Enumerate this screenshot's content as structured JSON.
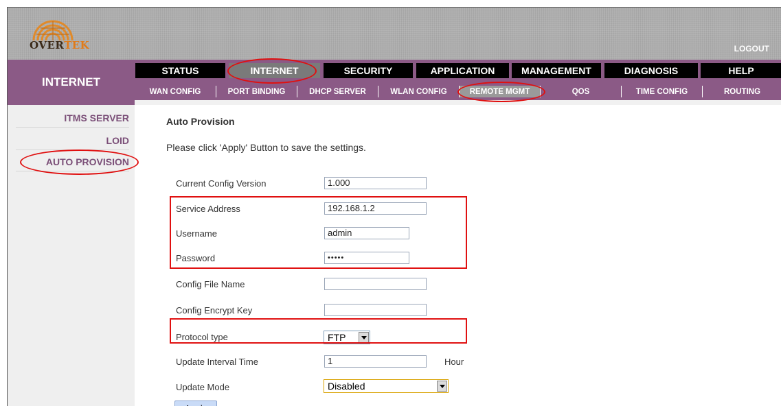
{
  "brand": {
    "logo_prefix": "OVER",
    "logo_suffix": "TEK",
    "logout_label": "LOGOUT"
  },
  "section_label": "INTERNET",
  "main_tabs": [
    {
      "label": "STATUS"
    },
    {
      "label": "INTERNET"
    },
    {
      "label": "SECURITY"
    },
    {
      "label": "APPLICATION"
    },
    {
      "label": "MANAGEMENT"
    },
    {
      "label": "DIAGNOSIS"
    },
    {
      "label": "HELP"
    }
  ],
  "sub_tabs": [
    {
      "label": "WAN CONFIG"
    },
    {
      "label": "PORT BINDING"
    },
    {
      "label": "DHCP SERVER"
    },
    {
      "label": "WLAN CONFIG"
    },
    {
      "label": "REMOTE MGMT"
    },
    {
      "label": "QOS"
    },
    {
      "label": "TIME CONFIG"
    },
    {
      "label": "ROUTING"
    }
  ],
  "sidebar": {
    "items": [
      {
        "label": "ITMS SERVER"
      },
      {
        "label": "LOID"
      },
      {
        "label": "AUTO PROVISION"
      }
    ]
  },
  "form": {
    "title": "Auto Provision",
    "instruction": "Please click 'Apply' Button to save the settings.",
    "fields": {
      "config_version": {
        "label": "Current Config Version",
        "value": "1.000"
      },
      "service_address": {
        "label": "Service Address",
        "value": "192.168.1.2"
      },
      "username": {
        "label": "Username",
        "value": "admin"
      },
      "password": {
        "label": "Password",
        "value": "•••••"
      },
      "config_file_name": {
        "label": "Config File Name",
        "value": ""
      },
      "config_encrypt_key": {
        "label": "Config Encrypt Key",
        "value": ""
      },
      "protocol_type": {
        "label": "Protocol type",
        "value": "FTP"
      },
      "update_interval": {
        "label": "Update Interval Time",
        "value": "1",
        "unit": "Hour"
      },
      "update_mode": {
        "label": "Update Mode",
        "value": "Disabled"
      }
    },
    "apply_label": "Apply"
  },
  "colors": {
    "accent_purple": "#8b5a86",
    "sidebar_text": "#7b4f78",
    "annotation_red": "#e01010"
  }
}
